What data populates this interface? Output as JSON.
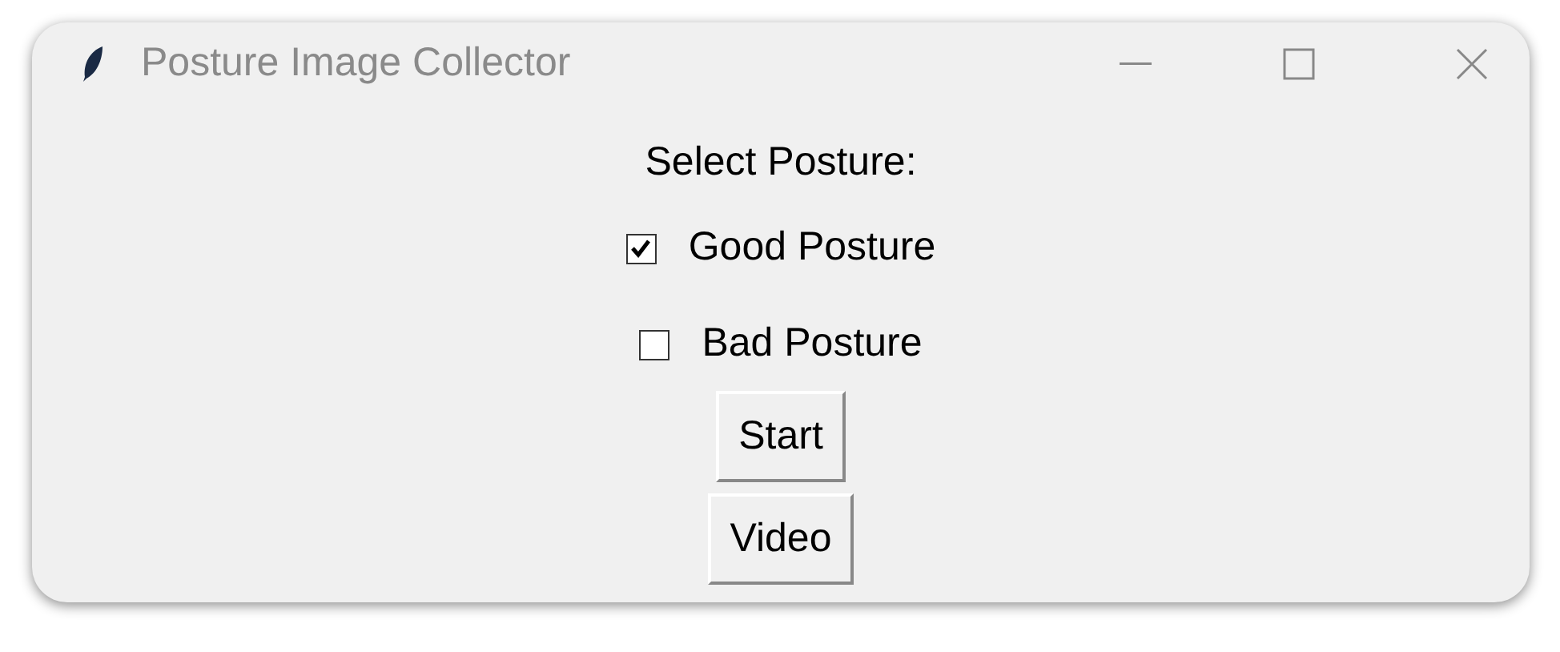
{
  "window": {
    "title": "Posture Image Collector"
  },
  "label": "Select Posture:",
  "checkboxes": [
    {
      "label": "Good Posture",
      "checked": true
    },
    {
      "label": "Bad Posture",
      "checked": false
    }
  ],
  "buttons": [
    "Start",
    "Video"
  ]
}
